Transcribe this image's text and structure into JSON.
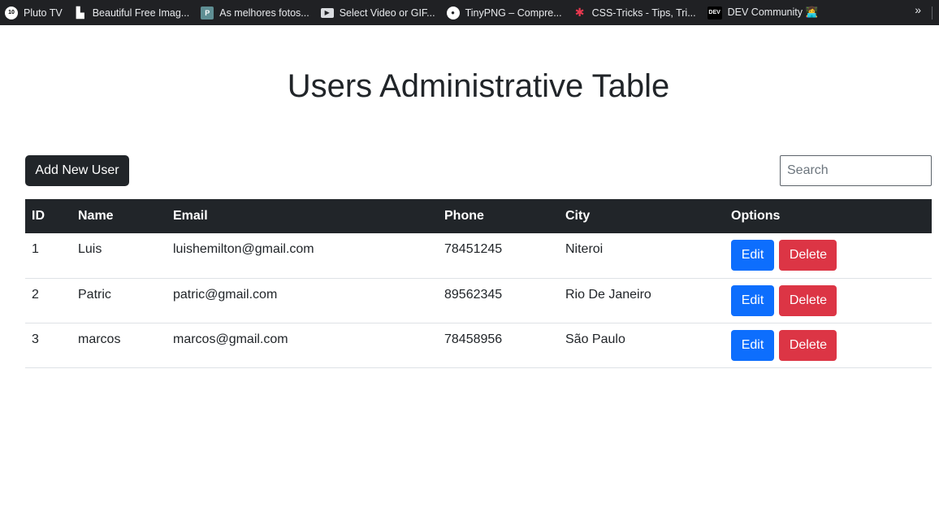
{
  "bookmarks": [
    {
      "label": "Pluto TV",
      "icon": "pluto-icon",
      "icon_text": "10",
      "icon_bg": "#ffffff",
      "icon_fg": "#000000"
    },
    {
      "label": "Beautiful Free Imag...",
      "icon": "unsplash-icon",
      "icon_text": "▙",
      "icon_bg": "#202124",
      "icon_fg": "#ffffff"
    },
    {
      "label": "As melhores fotos...",
      "icon": "pexels-icon",
      "icon_text": "P",
      "icon_bg": "#5f8f94",
      "icon_fg": "#ffffff"
    },
    {
      "label": "Select Video or GIF...",
      "icon": "video-icon",
      "icon_text": "▶",
      "icon_bg": "#dadce0",
      "icon_fg": "#202124"
    },
    {
      "label": "TinyPNG – Compre...",
      "icon": "panda-icon",
      "icon_text": "●",
      "icon_bg": "#ffffff",
      "icon_fg": "#202124"
    },
    {
      "label": "CSS-Tricks - Tips, Tri...",
      "icon": "asterisk-icon",
      "icon_text": "✱",
      "icon_bg": "#202124",
      "icon_fg": "#e8384f"
    },
    {
      "label": "DEV Community 👩‍💻",
      "icon": "dev-icon",
      "icon_text": "DEV",
      "icon_bg": "#000000",
      "icon_fg": "#ffffff"
    }
  ],
  "bookmarks_more": "»",
  "page_title": "Users Administrative Table",
  "add_button": "Add New User",
  "search_placeholder": "Search",
  "table": {
    "headers": [
      "ID",
      "Name",
      "Email",
      "Phone",
      "City",
      "Options"
    ],
    "rows": [
      {
        "id": "1",
        "name": "Luis",
        "email": "luishemilton@gmail.com",
        "phone": "78451245",
        "city": "Niteroi"
      },
      {
        "id": "2",
        "name": "Patric",
        "email": "patric@gmail.com",
        "phone": "89562345",
        "city": "Rio De Janeiro"
      },
      {
        "id": "3",
        "name": "marcos",
        "email": "marcos@gmail.com",
        "phone": "78458956",
        "city": "São Paulo"
      }
    ],
    "edit_label": "Edit",
    "delete_label": "Delete"
  },
  "colors": {
    "dark": "#212529",
    "primary": "#0d6efd",
    "danger": "#dc3545"
  }
}
